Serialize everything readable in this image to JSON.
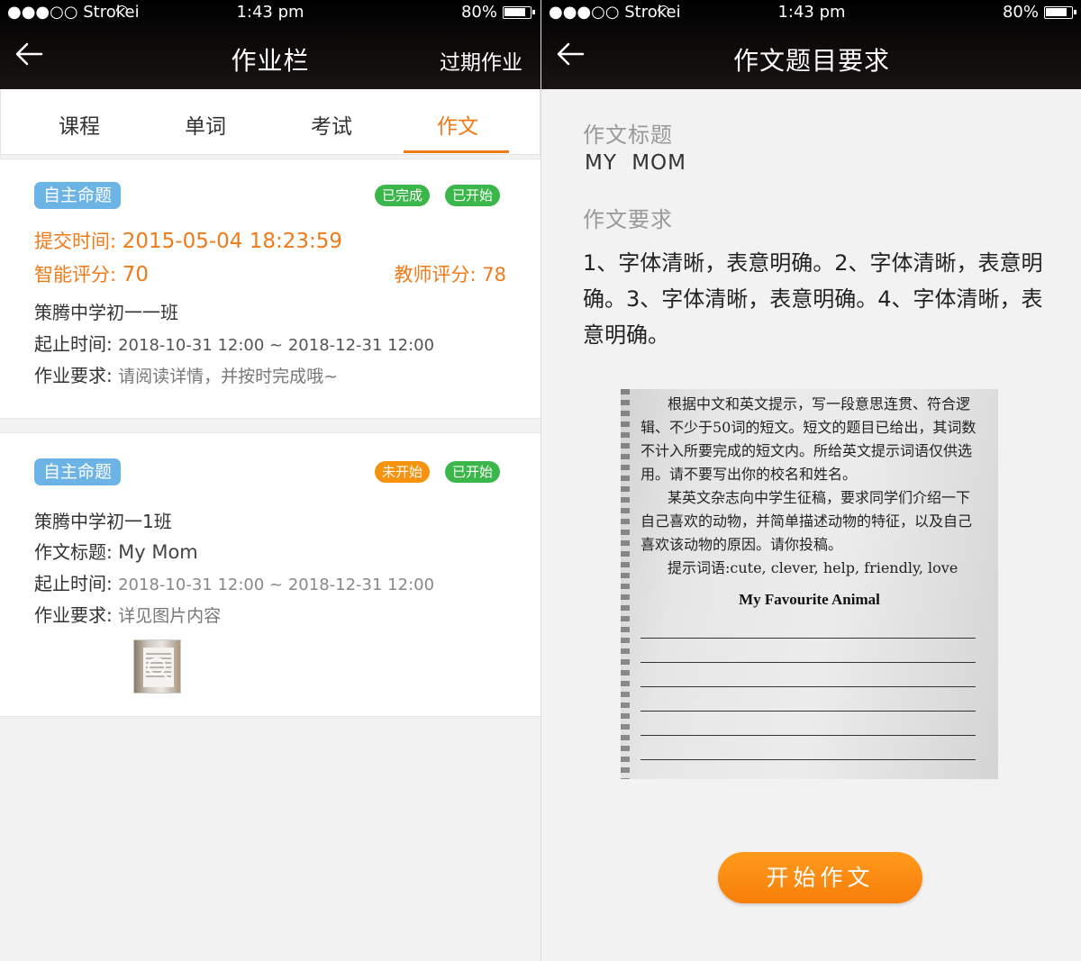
{
  "status": {
    "carrier": "●●●○○ Strokei",
    "time": "1:43 pm",
    "battery": "80%"
  },
  "left": {
    "nav": {
      "title": "作业栏",
      "right_link": "过期作业"
    },
    "tabs": [
      "课程",
      "单词",
      "考试",
      "作文"
    ],
    "active_tab": "作文",
    "cards": [
      {
        "tag": "自主命题",
        "badges": [
          "已完成",
          "已开始"
        ],
        "submit_label": "提交时间:",
        "submit_time": "2015-05-04 18:23:59",
        "ai_score_label": "智能评分:",
        "ai_score": "70",
        "teacher_score_label": "教师评分:",
        "teacher_score": "78",
        "class_name": "策腾中学初一一班",
        "period_label": "起止时间:",
        "period": "2018-10-31 12:00 ~ 2018-12-31 12:00",
        "req_label": "作业要求:",
        "req": "请阅读详情，并按时完成哦~"
      },
      {
        "tag": "自主命题",
        "badges": [
          "未开始",
          "已开始"
        ],
        "class_name": "策腾中学初一1班",
        "essay_title_label": "作文标题:",
        "essay_title": "My Mom",
        "period_label": "起止时间:",
        "period": "2018-10-31 12:00 ~ 2018-12-31 12:00",
        "req_label": "作业要求:",
        "req": "详见图片内容"
      }
    ]
  },
  "right": {
    "nav": {
      "title": "作文题目要求"
    },
    "title_label": "作文标题",
    "title_value": "MY  MOM",
    "req_label": "作文要求",
    "req_text": "1、字体清晰，表意明确。2、字体清晰，表意明确。3、字体清晰，表意明确。4、字体清晰，表意明确。",
    "photo": {
      "para1": "根据中文和英文提示，写一段意思连贯、符合逻辑、不少于50词的短文。短文的题目已给出，其词数不计入所要完成的短文内。所给英文提示词语仅供选用。请不要写出你的校名和姓名。",
      "para2": "某英文杂志向中学生征稿，要求同学们介绍一下自己喜欢的动物，并简单描述动物的特征，以及自己喜欢该动物的原因。请你投稿。",
      "hint": "提示词语:cute, clever, help, friendly, love",
      "heading": "My Favourite Animal"
    },
    "start_button": "开始作文"
  },
  "colors": {
    "accent": "#f07a18",
    "tag_blue": "#6cb3e6",
    "green": "#3bb64a",
    "orange": "#f5930e"
  }
}
